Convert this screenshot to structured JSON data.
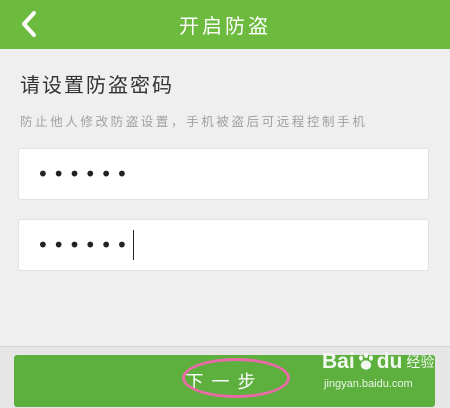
{
  "header": {
    "title": "开启防盗",
    "back_icon": "chevron-left-icon"
  },
  "content": {
    "section_title": "请设置防盗密码",
    "section_desc": "防止他人修改防盗设置，手机被盗后可远程控制手机",
    "password_field": {
      "value": "••••••"
    },
    "confirm_password_field": {
      "value": "••••••"
    }
  },
  "footer": {
    "next_button_label": "下一步"
  },
  "watermark": {
    "brand": "Bai",
    "brand_suffix": "du",
    "jingyan": "经验",
    "url": "jingyan.baidu.com"
  },
  "colors": {
    "header_green": "#6cba3e",
    "button_green": "#5db03e",
    "annotation_pink": "#e86aa6"
  }
}
